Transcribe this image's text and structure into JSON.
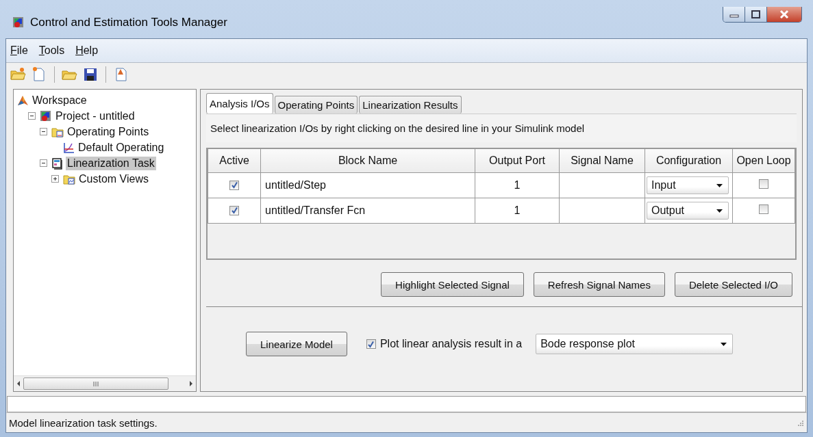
{
  "window": {
    "title": "Control and Estimation Tools Manager"
  },
  "menu": [
    {
      "mnemonic": "F",
      "rest": "ile"
    },
    {
      "mnemonic": "T",
      "rest": "ools"
    },
    {
      "mnemonic": "H",
      "rest": "elp"
    }
  ],
  "tree": [
    {
      "label": "Workspace",
      "kind": "workspace",
      "children": [
        {
          "label": "Project - untitled",
          "kind": "project",
          "expanded": true,
          "selected": false,
          "children": [
            {
              "label": "Operating Points",
              "kind": "folder",
              "expanded": true,
              "selected": false,
              "children": [
                {
                  "label": "Default Operating",
                  "kind": "point",
                  "selected": false
                }
              ]
            },
            {
              "label": "Linearization Task",
              "kind": "task",
              "expanded": true,
              "selected": true,
              "children": [
                {
                  "label": "Custom Views",
                  "kind": "views",
                  "expanded": false,
                  "selected": false
                }
              ]
            }
          ]
        }
      ]
    }
  ],
  "tabs": [
    {
      "label": "Analysis I/Os",
      "selected": true
    },
    {
      "label": "Operating Points",
      "selected": false
    },
    {
      "label": "Linearization Results",
      "selected": false
    }
  ],
  "instructions": "Select linearization I/Os by right clicking on the desired line in your Simulink model",
  "table": {
    "columns": [
      "Active",
      "Block Name",
      "Output Port",
      "Signal Name",
      "Configuration",
      "Open Loop"
    ],
    "rows": [
      {
        "active": true,
        "block_name": "untitled/Step",
        "output_port": "1",
        "configuration": "Input",
        "open_loop": false
      },
      {
        "active": true,
        "block_name": "untitled/Transfer Fcn",
        "output_port": "1",
        "configuration": "Output",
        "open_loop": false
      }
    ]
  },
  "io_buttons": [
    "Highlight Selected Signal",
    "Refresh Signal Names",
    "Delete Selected I/O"
  ],
  "linearize": {
    "button": "Linearize Model",
    "plot_checked": true,
    "plot_label": "Plot linear analysis result in a",
    "plot_type": "Bode response plot"
  },
  "status_bar": {
    "message": "Model linearization task settings."
  }
}
